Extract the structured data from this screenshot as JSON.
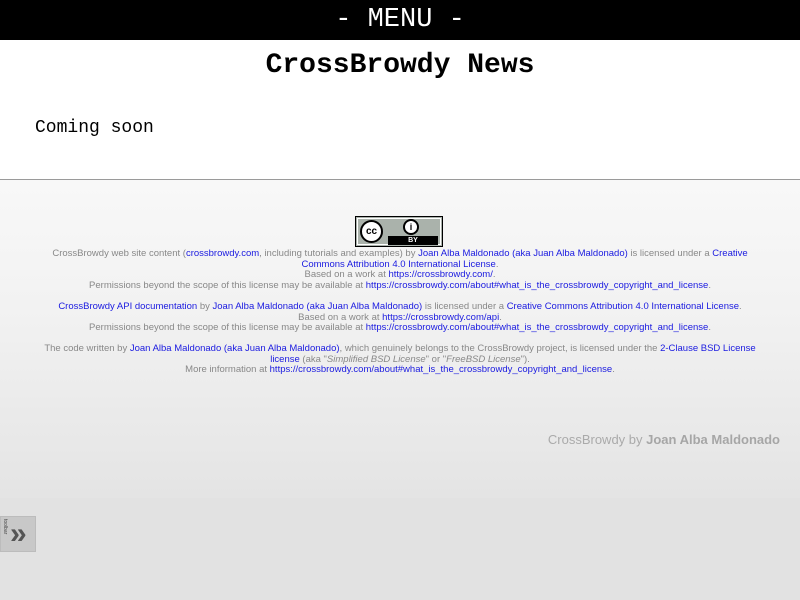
{
  "menu": {
    "label": "- MENU -"
  },
  "page": {
    "title": "CrossBrowdy News",
    "body_text": "Coming soon"
  },
  "license_badge": {
    "cc_text": "cc",
    "by_symbol": "i",
    "by_text": "BY"
  },
  "legal": {
    "p1": {
      "t1": "CrossBrowdy web site content (",
      "l1": "crossbrowdy.com",
      "t2": ", including tutorials and examples) by ",
      "l2": "Joan Alba Maldonado (aka Juan Alba Maldonado)",
      "t3": " is licensed under a ",
      "l3": "Creative Commons Attribution 4.0 International License",
      "t4": ".",
      "t5": "Based on a work at ",
      "l4": "https://crossbrowdy.com/",
      "t6": ".",
      "t7": "Permissions beyond the scope of this license may be available at ",
      "l5": "https://crossbrowdy.com/about#what_is_the_crossbrowdy_copyright_and_license",
      "t8": "."
    },
    "p2": {
      "l1": "CrossBrowdy API documentation",
      "t1": " by ",
      "l2": "Joan Alba Maldonado (aka Juan Alba Maldonado)",
      "t2": " is licensed under a ",
      "l3": "Creative Commons Attribution 4.0 International License",
      "t3": ".",
      "t4": "Based on a work at ",
      "l4": "https://crossbrowdy.com/api",
      "t5": ".",
      "t6": "Permissions beyond the scope of this license may be available at ",
      "l5": "https://crossbrowdy.com/about#what_is_the_crossbrowdy_copyright_and_license",
      "t7": "."
    },
    "p3": {
      "t1": "The code written by ",
      "l1": "Joan Alba Maldonado (aka Juan Alba Maldonado)",
      "t2": ", which genuinely belongs to the CrossBrowdy project, is licensed under the ",
      "l2": "2-Clause BSD License license",
      "t3": " (aka \"",
      "i1": "Simplified BSD License",
      "t4": "\" or \"",
      "i2": "FreeBSD License",
      "t5": "\").",
      "t6": "More information at ",
      "l3": "https://crossbrowdy.com/about#what_is_the_crossbrowdy_copyright_and_license",
      "t7": "."
    }
  },
  "credit": {
    "site": "CrossBrowdy",
    "by": " by ",
    "author": "Joan Alba Maldonado"
  },
  "toolbar_toggle": {
    "label": "toolbar",
    "symbol": "»"
  },
  "colors": {
    "menu_background": "#000000",
    "link": "#1a1ae0",
    "footer_text": "#888888"
  },
  "icons": [
    "cc-license-badge",
    "double-chevron-right-icon"
  ]
}
